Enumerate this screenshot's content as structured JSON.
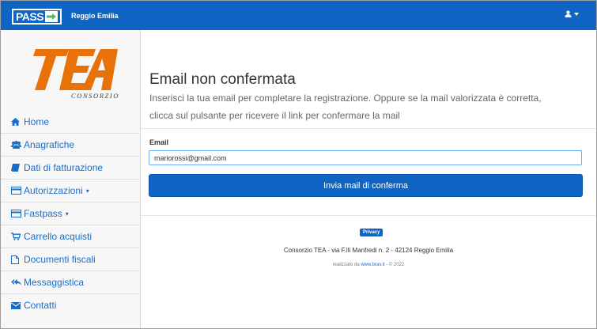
{
  "header": {
    "logo_text": "PASS",
    "city": "Reggio Emilia",
    "user_icon": "user-icon",
    "colors": {
      "bar": "#1065c4",
      "text": "#ffffff"
    }
  },
  "sidebar": {
    "brand": {
      "name": "TEA",
      "caption": "CONSORZIO",
      "color": "#e8710a"
    },
    "items": [
      {
        "label": "Home",
        "icon": "home-icon"
      },
      {
        "label": "Anagrafiche",
        "icon": "users-icon"
      },
      {
        "label": "Dati di fatturazione",
        "icon": "book-icon"
      },
      {
        "label": "Autorizzazioni",
        "icon": "card-icon",
        "dropdown": true
      },
      {
        "label": "Fastpass",
        "icon": "card-icon",
        "dropdown": true
      },
      {
        "label": "Carrello acquisti",
        "icon": "cart-icon"
      },
      {
        "label": "Documenti fiscali",
        "icon": "file-icon"
      },
      {
        "label": "Messaggistica",
        "icon": "reply-all-icon"
      },
      {
        "label": "Contatti",
        "icon": "envelope-icon"
      }
    ]
  },
  "main": {
    "title": "Email non confermata",
    "intro": "Inserisci la tua email per completare la registrazione. Oppure se la mail valorizzata è corretta, clicca sul pulsante per ricevere il link per confermare la mail",
    "email_label": "Email",
    "email_value": "mariorossi@gmail.com",
    "submit_label": "Invia mail di conferma"
  },
  "footer": {
    "privacy_label": "Privacy",
    "address": "Consorzio TEA - via F.lli Manfredi n. 2 - 42124 Reggio Emilia",
    "credit_prefix": "realizzato da ",
    "credit_link": "www.brav.it",
    "credit_suffix": " - © 2022"
  }
}
